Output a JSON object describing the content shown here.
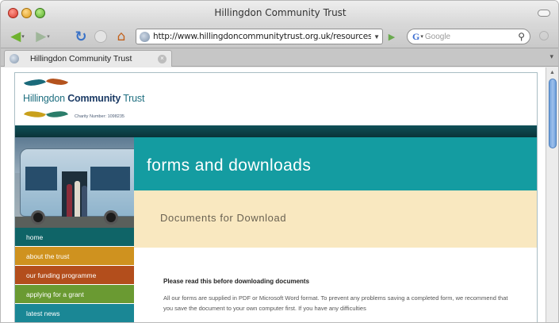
{
  "window": {
    "title": "Hillingdon Community Trust"
  },
  "toolbar": {
    "url": "http://www.hillingdoncommunitytrust.org.uk/resources.pl",
    "url_dropdown": "▼",
    "go": "▶",
    "search_engine_letter": "G",
    "search_engine_dropdown": "▾",
    "search_placeholder": "Google",
    "icons": {
      "back": "back-arrow-icon",
      "forward": "forward-arrow-icon",
      "reload": "reload-icon",
      "stop": "stop-icon",
      "home": "home-icon",
      "search": "magnifier-icon"
    }
  },
  "tabs": [
    {
      "title": "Hillingdon Community Trust",
      "active": true
    }
  ],
  "page": {
    "logo": {
      "name_light": "Hillingdon",
      "name_strong": "Community",
      "name_suffix": "Trust",
      "charity_number": "Charity Number: 1098235"
    },
    "hero_title": "forms and downloads",
    "section_title": "Documents for Download",
    "nav": [
      {
        "label": "home"
      },
      {
        "label": "about the trust"
      },
      {
        "label": "our funding programme"
      },
      {
        "label": "applying for a grant"
      },
      {
        "label": "latest news"
      }
    ],
    "content": {
      "heading": "Please read this before downloading documents",
      "paragraph": "All our forms are supplied in PDF or Microsoft Word format. To prevent any problems saving a completed form, we recommend that you save the document to your own computer first. If you have any difficulties"
    },
    "colors": {
      "teal": "#149ca1",
      "dark_band": "#0f5058",
      "cream": "#f9e8c0",
      "nav_home": "#0f6467",
      "nav_about": "#cf921f",
      "nav_funding": "#b34e1c",
      "nav_applying": "#6a9a32",
      "nav_news": "#1a8795"
    }
  }
}
